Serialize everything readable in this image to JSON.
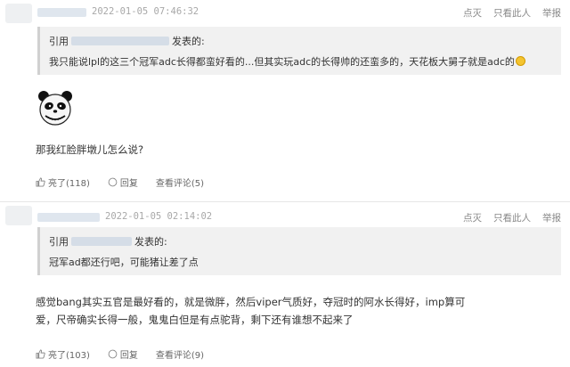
{
  "posts": [
    {
      "time": "2022-01-05 07:46:32",
      "actions": [
        "点灭",
        "只看此人",
        "举报"
      ],
      "quote": {
        "prefix": "引用",
        "suffix": "发表的:",
        "text": "我只能说lpl的这三个冠军adc长得都蛮好看的...但其实玩adc的长得帅的还蛮多的，天花板大舅子就是adc的"
      },
      "has_sticker": true,
      "sticker_icon": "panda-face-sticker",
      "body": "那我红脸胖墩儿怎么说?",
      "footer": {
        "like": "亮了(118)",
        "reply": "回复",
        "view_comments": "查看评论(5)"
      }
    },
    {
      "time": "2022-01-05 02:14:02",
      "actions": [
        "点灭",
        "只看此人",
        "举报"
      ],
      "quote": {
        "prefix": "引用",
        "suffix": "发表的:",
        "text": "冠军ad都还行吧，可能猪让差了点"
      },
      "body": "感觉bang其实五官是最好看的，就是微胖，然后viper气质好，夺冠时的阿水长得好，imp算可爱，尺帝确实长得一般，鬼鬼白但是有点驼背，剩下还有谁想不起来了",
      "footer": {
        "like": "亮了(103)",
        "reply": "回复",
        "view_comments": "查看评论(9)"
      }
    }
  ],
  "colors": {
    "quote_bg": "#f1f1f1",
    "muted_text": "#a8a8a8",
    "redacted_name": "#dfe6ee"
  }
}
